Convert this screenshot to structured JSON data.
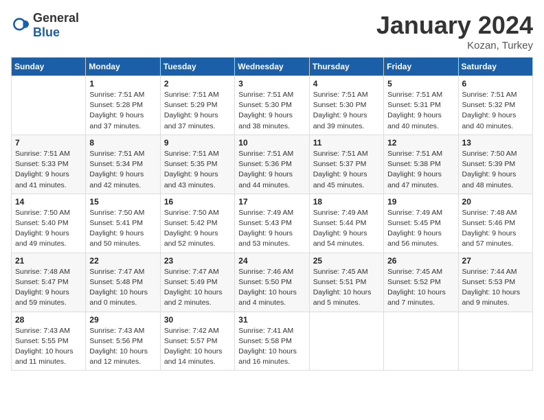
{
  "header": {
    "logo_general": "General",
    "logo_blue": "Blue",
    "month_title": "January 2024",
    "location": "Kozan, Turkey"
  },
  "weekdays": [
    "Sunday",
    "Monday",
    "Tuesday",
    "Wednesday",
    "Thursday",
    "Friday",
    "Saturday"
  ],
  "weeks": [
    [
      {
        "day": "",
        "info": ""
      },
      {
        "day": "1",
        "info": "Sunrise: 7:51 AM\nSunset: 5:28 PM\nDaylight: 9 hours\nand 37 minutes."
      },
      {
        "day": "2",
        "info": "Sunrise: 7:51 AM\nSunset: 5:29 PM\nDaylight: 9 hours\nand 37 minutes."
      },
      {
        "day": "3",
        "info": "Sunrise: 7:51 AM\nSunset: 5:30 PM\nDaylight: 9 hours\nand 38 minutes."
      },
      {
        "day": "4",
        "info": "Sunrise: 7:51 AM\nSunset: 5:30 PM\nDaylight: 9 hours\nand 39 minutes."
      },
      {
        "day": "5",
        "info": "Sunrise: 7:51 AM\nSunset: 5:31 PM\nDaylight: 9 hours\nand 40 minutes."
      },
      {
        "day": "6",
        "info": "Sunrise: 7:51 AM\nSunset: 5:32 PM\nDaylight: 9 hours\nand 40 minutes."
      }
    ],
    [
      {
        "day": "7",
        "info": "Sunrise: 7:51 AM\nSunset: 5:33 PM\nDaylight: 9 hours\nand 41 minutes."
      },
      {
        "day": "8",
        "info": "Sunrise: 7:51 AM\nSunset: 5:34 PM\nDaylight: 9 hours\nand 42 minutes."
      },
      {
        "day": "9",
        "info": "Sunrise: 7:51 AM\nSunset: 5:35 PM\nDaylight: 9 hours\nand 43 minutes."
      },
      {
        "day": "10",
        "info": "Sunrise: 7:51 AM\nSunset: 5:36 PM\nDaylight: 9 hours\nand 44 minutes."
      },
      {
        "day": "11",
        "info": "Sunrise: 7:51 AM\nSunset: 5:37 PM\nDaylight: 9 hours\nand 45 minutes."
      },
      {
        "day": "12",
        "info": "Sunrise: 7:51 AM\nSunset: 5:38 PM\nDaylight: 9 hours\nand 47 minutes."
      },
      {
        "day": "13",
        "info": "Sunrise: 7:50 AM\nSunset: 5:39 PM\nDaylight: 9 hours\nand 48 minutes."
      }
    ],
    [
      {
        "day": "14",
        "info": "Sunrise: 7:50 AM\nSunset: 5:40 PM\nDaylight: 9 hours\nand 49 minutes."
      },
      {
        "day": "15",
        "info": "Sunrise: 7:50 AM\nSunset: 5:41 PM\nDaylight: 9 hours\nand 50 minutes."
      },
      {
        "day": "16",
        "info": "Sunrise: 7:50 AM\nSunset: 5:42 PM\nDaylight: 9 hours\nand 52 minutes."
      },
      {
        "day": "17",
        "info": "Sunrise: 7:49 AM\nSunset: 5:43 PM\nDaylight: 9 hours\nand 53 minutes."
      },
      {
        "day": "18",
        "info": "Sunrise: 7:49 AM\nSunset: 5:44 PM\nDaylight: 9 hours\nand 54 minutes."
      },
      {
        "day": "19",
        "info": "Sunrise: 7:49 AM\nSunset: 5:45 PM\nDaylight: 9 hours\nand 56 minutes."
      },
      {
        "day": "20",
        "info": "Sunrise: 7:48 AM\nSunset: 5:46 PM\nDaylight: 9 hours\nand 57 minutes."
      }
    ],
    [
      {
        "day": "21",
        "info": "Sunrise: 7:48 AM\nSunset: 5:47 PM\nDaylight: 9 hours\nand 59 minutes."
      },
      {
        "day": "22",
        "info": "Sunrise: 7:47 AM\nSunset: 5:48 PM\nDaylight: 10 hours\nand 0 minutes."
      },
      {
        "day": "23",
        "info": "Sunrise: 7:47 AM\nSunset: 5:49 PM\nDaylight: 10 hours\nand 2 minutes."
      },
      {
        "day": "24",
        "info": "Sunrise: 7:46 AM\nSunset: 5:50 PM\nDaylight: 10 hours\nand 4 minutes."
      },
      {
        "day": "25",
        "info": "Sunrise: 7:45 AM\nSunset: 5:51 PM\nDaylight: 10 hours\nand 5 minutes."
      },
      {
        "day": "26",
        "info": "Sunrise: 7:45 AM\nSunset: 5:52 PM\nDaylight: 10 hours\nand 7 minutes."
      },
      {
        "day": "27",
        "info": "Sunrise: 7:44 AM\nSunset: 5:53 PM\nDaylight: 10 hours\nand 9 minutes."
      }
    ],
    [
      {
        "day": "28",
        "info": "Sunrise: 7:43 AM\nSunset: 5:55 PM\nDaylight: 10 hours\nand 11 minutes."
      },
      {
        "day": "29",
        "info": "Sunrise: 7:43 AM\nSunset: 5:56 PM\nDaylight: 10 hours\nand 12 minutes."
      },
      {
        "day": "30",
        "info": "Sunrise: 7:42 AM\nSunset: 5:57 PM\nDaylight: 10 hours\nand 14 minutes."
      },
      {
        "day": "31",
        "info": "Sunrise: 7:41 AM\nSunset: 5:58 PM\nDaylight: 10 hours\nand 16 minutes."
      },
      {
        "day": "",
        "info": ""
      },
      {
        "day": "",
        "info": ""
      },
      {
        "day": "",
        "info": ""
      }
    ]
  ]
}
